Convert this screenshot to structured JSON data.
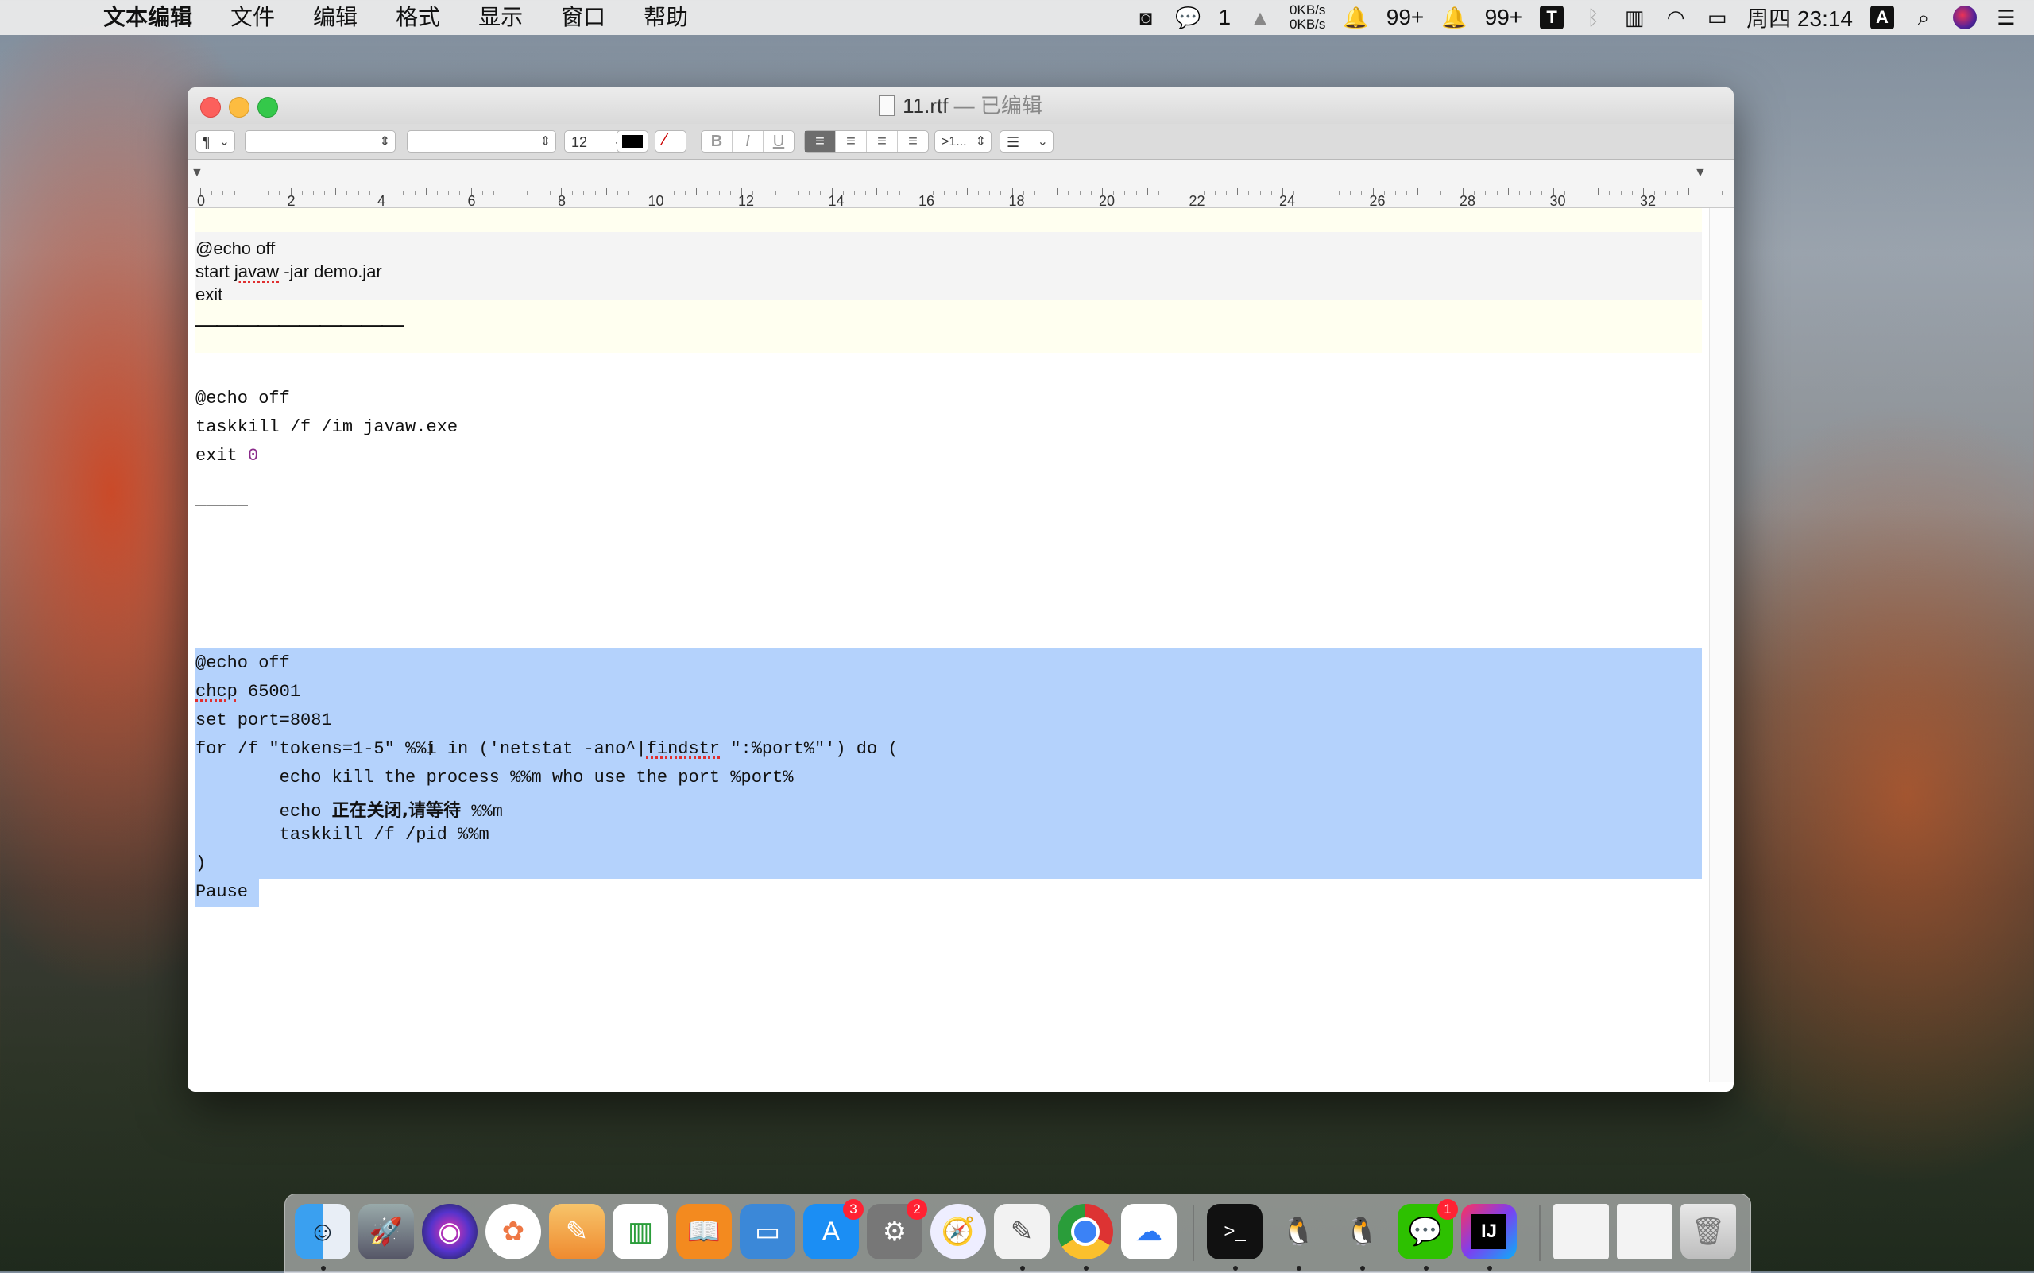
{
  "menubar": {
    "app_name": "文本编辑",
    "items": [
      "文件",
      "编辑",
      "格式",
      "显示",
      "窗口",
      "帮助"
    ],
    "status": {
      "net_up": "0KB/s",
      "net_down": "0KB/s",
      "wechat_count": "1",
      "qq1_count": "99+",
      "qq2_count": "99+",
      "input_method": "A",
      "clock": "周四 23:14"
    }
  },
  "window": {
    "title_file": "11.rtf",
    "title_state": " — 已编辑"
  },
  "toolbar": {
    "paragraph_style": "¶",
    "font_size": "12",
    "spacing": ">1...",
    "bold": "B",
    "italic": "I",
    "underline": "U"
  },
  "ruler": {
    "labels": [
      "0",
      "2",
      "4",
      "6",
      "8",
      "10",
      "12",
      "14",
      "16",
      "18",
      "20",
      "22",
      "24",
      "26",
      "28",
      "30",
      "32"
    ]
  },
  "document": {
    "block1": [
      "@echo off",
      "start ",
      "javaw",
      " -jar demo.jar",
      "exit"
    ],
    "separator1": "——————————",
    "block2": [
      "@echo off",
      "taskkill /f /im javaw.exe",
      "exit ",
      "0"
    ],
    "separator2": "_____",
    "block3": {
      "l1": "@echo off",
      "l2a": "chcp",
      "l2b": " 65001",
      "l3": "set port=8081",
      "l4a": "for /f \"tokens=1-5\" %%i in ('netstat -ano^|",
      "l4b": "findstr",
      "l4c": " \":%port%\"') do (",
      "l5": "        echo kill the process %%m who use the port %port%",
      "l6a": "        echo ",
      "l6b": "正在关闭,请等待",
      "l6c": " %%m",
      "l7": "        taskkill /f /pid %%m",
      "l8": ")",
      "l9": "Pause"
    }
  },
  "dock": {
    "badges": {
      "appstore": "3",
      "preferences": "2",
      "wechat": "1"
    },
    "icons": [
      "finder-icon",
      "launchpad-icon",
      "siri-icon",
      "photos-icon",
      "pages-icon",
      "numbers-icon",
      "books-icon",
      "keynote-icon",
      "appstore-icon",
      "system-preferences-icon",
      "safari-icon",
      "textedit-icon",
      "chrome-icon",
      "baidu-netdisk-icon",
      "terminal-icon",
      "qq-icon",
      "qq-icon-2",
      "wechat-icon",
      "intellij-icon",
      "recent-window-1",
      "recent-window-2",
      "trash-icon"
    ]
  }
}
